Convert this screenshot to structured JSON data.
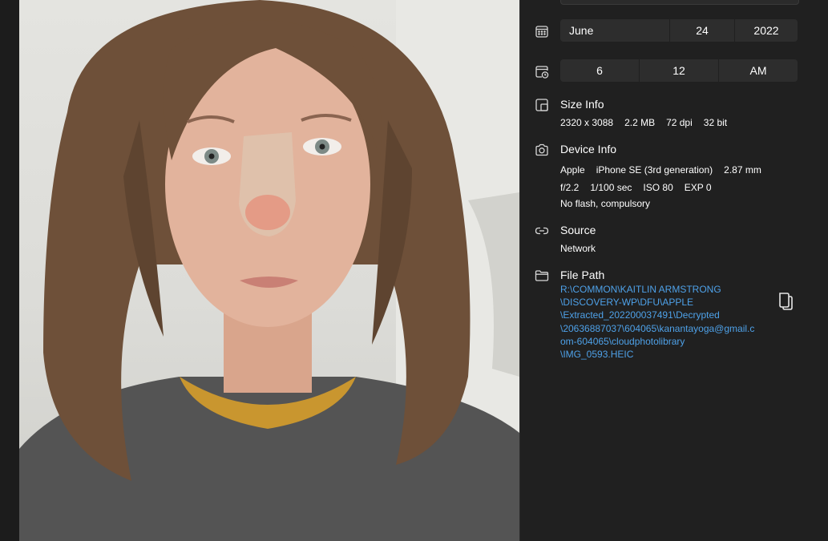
{
  "date": {
    "month": "June",
    "day": "24",
    "year": "2022"
  },
  "time": {
    "hour": "6",
    "minute": "12",
    "period": "AM"
  },
  "size_info": {
    "title": "Size Info",
    "dimensions": "2320 x 3088",
    "file_size": "2.2 MB",
    "dpi": "72 dpi",
    "bit_depth": "32 bit"
  },
  "device_info": {
    "title": "Device Info",
    "make": "Apple",
    "model": "iPhone SE (3rd generation)",
    "focal_length": "2.87 mm",
    "aperture": "f/2.2",
    "shutter": "1/100 sec",
    "iso": "ISO 80",
    "exposure": "EXP 0",
    "flash": "No flash, compulsory"
  },
  "source": {
    "title": "Source",
    "value": "Network"
  },
  "file_path": {
    "title": "File Path",
    "lines": [
      "R:\\COMMON\\KAITLIN ARMSTRONG",
      "\\DISCOVERY-WP\\DFU\\APPLE",
      "\\Extracted_202200037491\\Decrypted",
      "\\20636887037\\604065\\kanantayoga@gmail.c",
      "om-604065\\cloudphotolibrary",
      "\\IMG_0593.HEIC"
    ]
  },
  "icons": {
    "date": "calendar-icon",
    "time": "calendar-clock-icon",
    "size": "image-size-icon",
    "device": "camera-icon",
    "source": "link-icon",
    "path": "folder-icon",
    "copy": "copy-icon"
  },
  "colors": {
    "panel_bg": "#202020",
    "segment_bg": "#2d2d2d",
    "link": "#4ea1e8",
    "text": "#ffffff"
  }
}
